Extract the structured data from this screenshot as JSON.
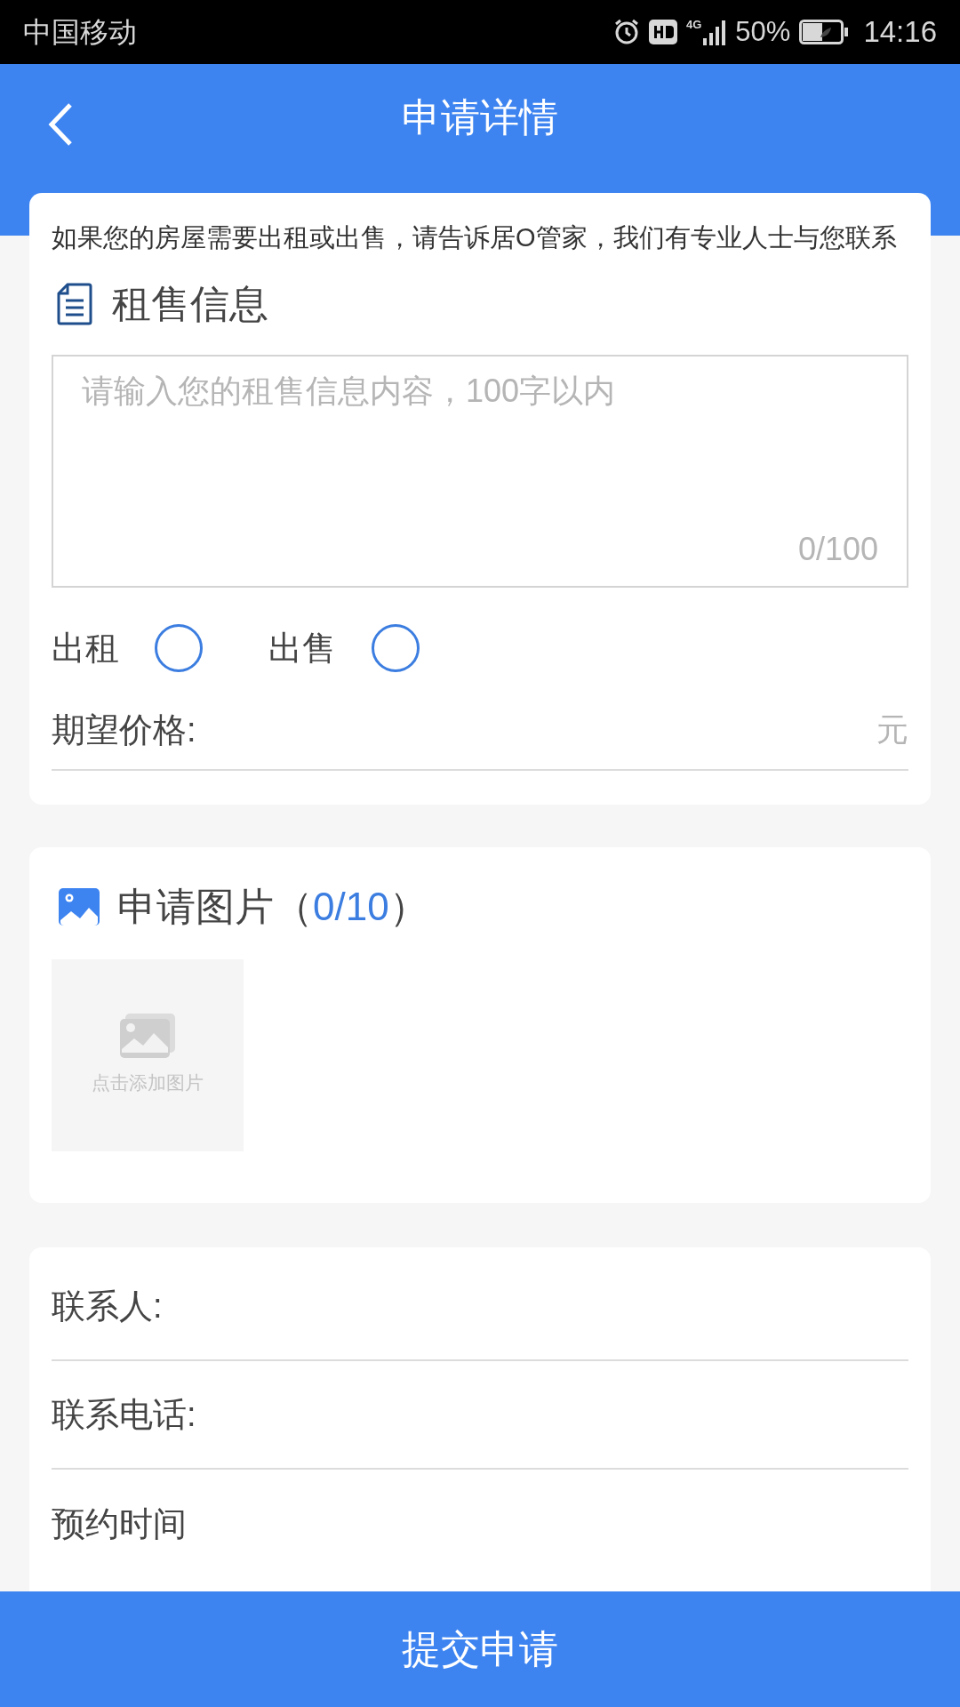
{
  "status_bar": {
    "carrier": "中国移动",
    "network": "4G",
    "battery": "50%",
    "time": "14:16"
  },
  "header": {
    "title": "申请详情"
  },
  "info_card": {
    "intro": "如果您的房屋需要出租或出售，请告诉居O管家，我们有专业人士与您联系",
    "heading": "租售信息",
    "textarea": {
      "placeholder": "请输入您的租售信息内容，100字以内",
      "counter": "0/100"
    },
    "options": [
      {
        "label": "出租",
        "selected": false
      },
      {
        "label": "出售",
        "selected": false
      }
    ],
    "price": {
      "label": "期望价格:",
      "unit": "元"
    }
  },
  "photo_card": {
    "heading": "申请图片（",
    "count": "0/10",
    "heading_end": "）",
    "add_label": "点击添加图片"
  },
  "contact_card": {
    "fields": [
      {
        "label": "联系人:"
      },
      {
        "label": "联系电话:"
      },
      {
        "label": "预约时间"
      }
    ]
  },
  "submit": "提交申请"
}
